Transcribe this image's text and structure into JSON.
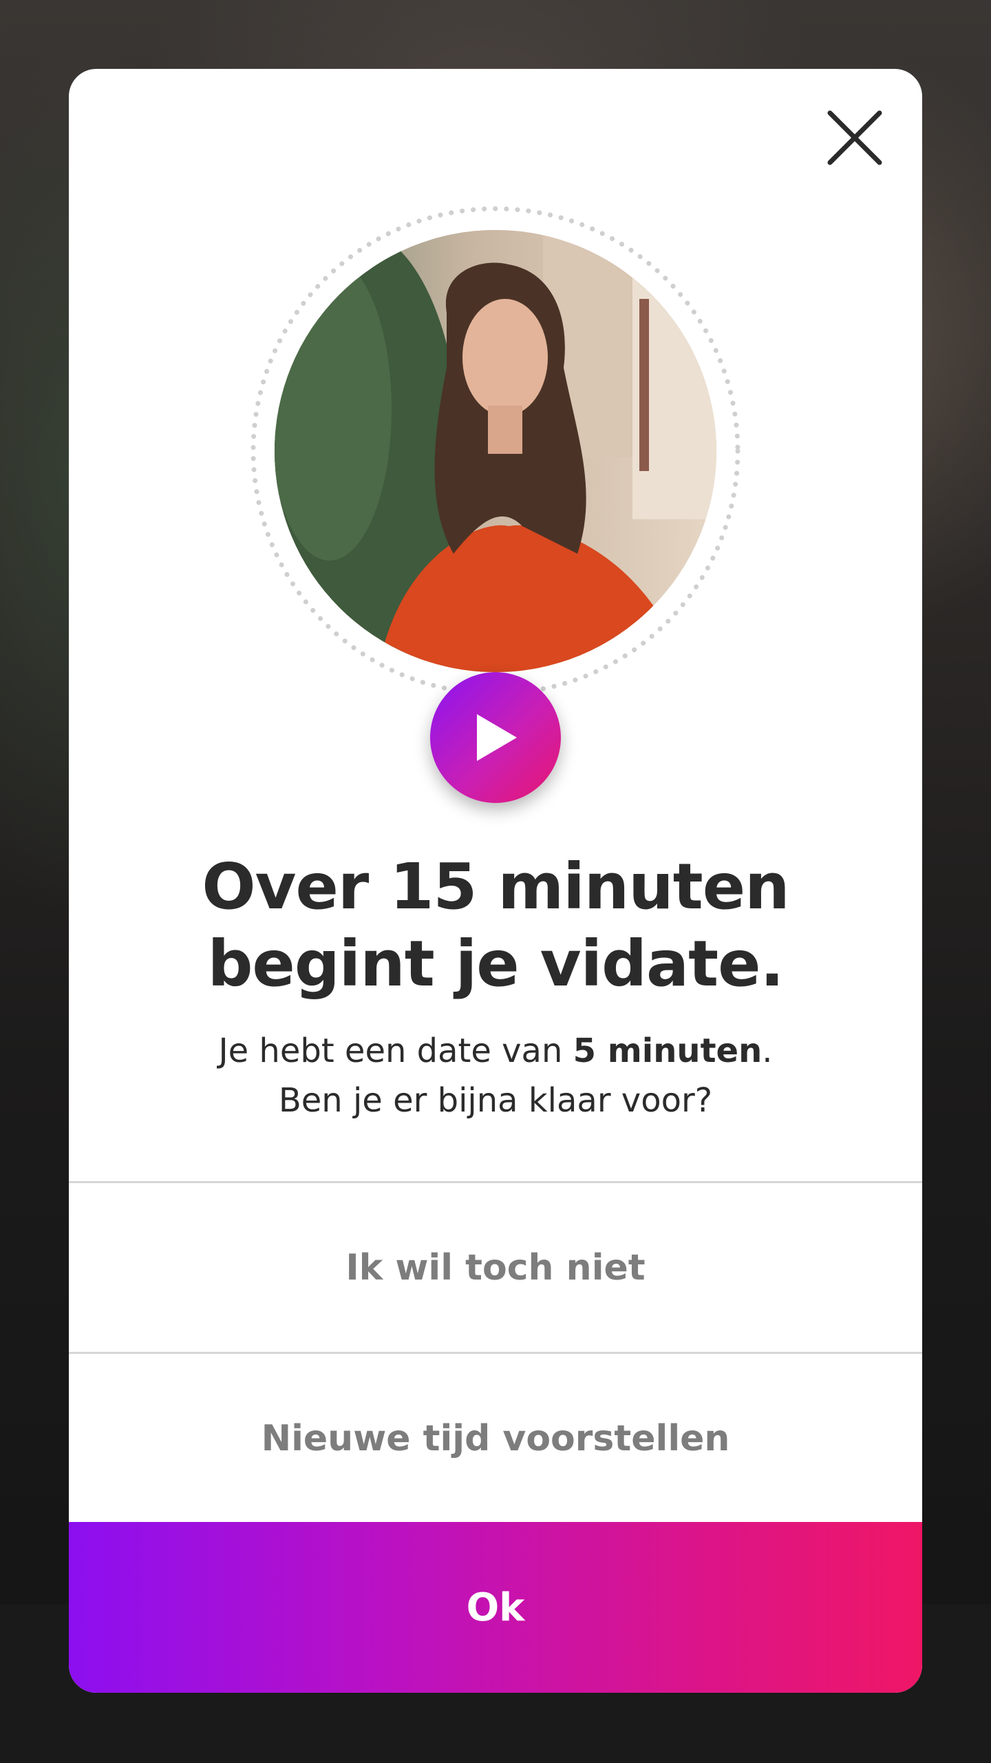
{
  "dialog": {
    "close_icon": "close-icon",
    "play_icon": "play-icon",
    "title_line1": "Over 15 minuten",
    "title_line2": "begint je vidate.",
    "subtitle_prefix": "Je hebt een date van ",
    "subtitle_bold": "5 minuten",
    "subtitle_suffix": ".",
    "subtitle_line2": "Ben je er bijna klaar voor?",
    "decline_label": "Ik wil toch niet",
    "reschedule_label": "Nieuwe tijd voorstellen",
    "ok_label": "Ok"
  },
  "colors": {
    "accent_start": "#8c0ff0",
    "accent_end": "#ef1666",
    "title_text": "#2b2b2b",
    "option_text": "#7d7d7d"
  }
}
